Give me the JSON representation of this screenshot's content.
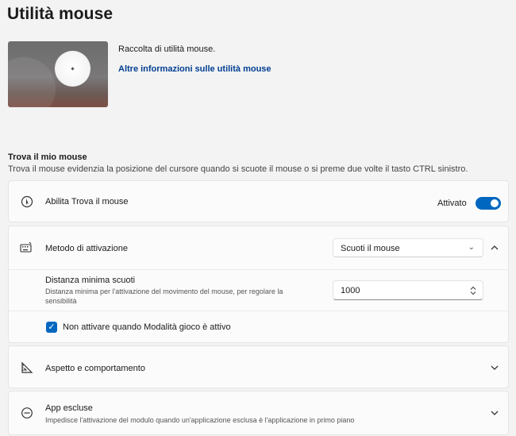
{
  "header": {
    "title": "Utilità mouse"
  },
  "hero": {
    "description": "Raccolta di utilità mouse.",
    "link": "Altre informazioni sulle utilità mouse"
  },
  "section": {
    "title": "Trova il mio mouse",
    "description": "Trova il mouse evidenzia la posizione del cursore quando si scuote il mouse o si preme due volte il tasto CTRL sinistro."
  },
  "enable": {
    "label": "Abilita Trova il mouse",
    "state_label": "Attivato",
    "enabled": true
  },
  "activation": {
    "label": "Metodo di attivazione",
    "selected": "Scuoti il mouse",
    "min_distance": {
      "label": "Distanza minima scuoti",
      "description": "Distanza minima per l'attivazione del movimento del mouse, per regolare la sensibilità",
      "value": "1000"
    },
    "game_mode": {
      "label": "Non attivare quando Modalità gioco è attivo",
      "checked": true
    }
  },
  "appearance": {
    "label": "Aspetto e comportamento"
  },
  "excluded": {
    "label": "App escluse",
    "description": "Impedisce l'attivazione del modulo quando un'applicazione esclusa è l'applicazione in primo piano"
  },
  "colors": {
    "accent": "#0067c0",
    "link": "#003e92"
  }
}
